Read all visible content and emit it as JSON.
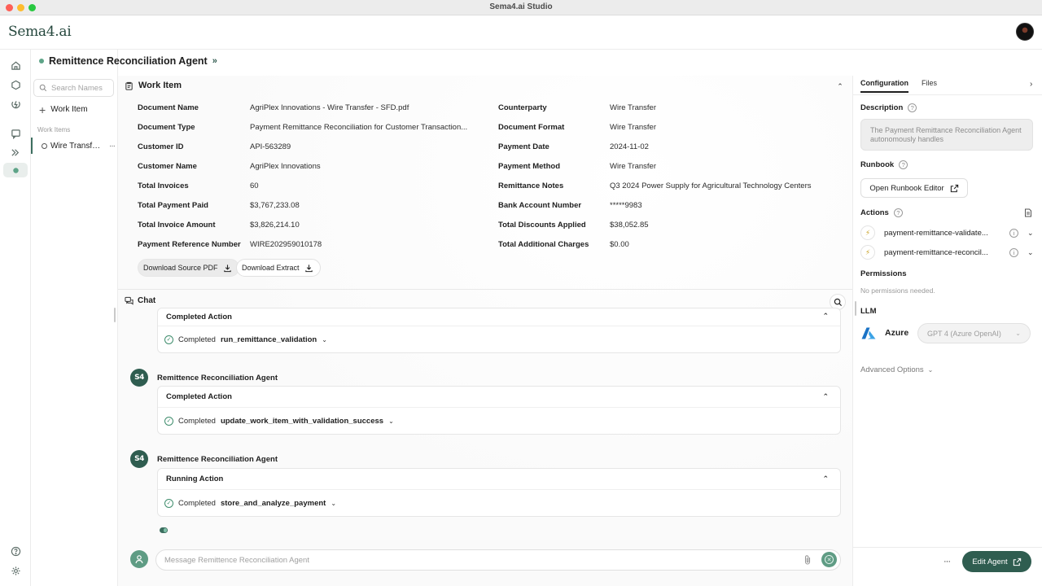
{
  "window": {
    "title": "Sema4.ai Studio"
  },
  "app": {
    "logo": "Sema4.ai"
  },
  "agent": {
    "name": "Remittence Reconciliation Agent",
    "chevrons": "»"
  },
  "sidebar": {
    "search_placeholder": "Search Names",
    "add_label": "Work Item",
    "section_label": "Work Items",
    "items": [
      {
        "label": "Wire Transfer..."
      }
    ]
  },
  "work_item": {
    "title": "Work Item",
    "left_fields": [
      {
        "key": "Document Name",
        "value": "AgriPlex Innovations - Wire Transfer - SFD.pdf"
      },
      {
        "key": "Document Type",
        "value": "Payment Remittance Reconciliation for Customer Transaction..."
      },
      {
        "key": "Customer ID",
        "value": "API-563289"
      },
      {
        "key": "Customer Name",
        "value": "AgriPlex Innovations"
      },
      {
        "key": "Total Invoices",
        "value": "60"
      },
      {
        "key": "Total Payment Paid",
        "value": "$3,767,233.08"
      },
      {
        "key": "Total Invoice Amount",
        "value": "$3,826,214.10"
      },
      {
        "key": "Payment Reference Number",
        "value": "WIRE202959010178"
      }
    ],
    "right_fields": [
      {
        "key": "Counterparty",
        "value": "Wire Transfer"
      },
      {
        "key": "Document Format",
        "value": "Wire Transfer"
      },
      {
        "key": "Payment Date",
        "value": "2024-11-02"
      },
      {
        "key": "Payment Method",
        "value": "Wire Transfer"
      },
      {
        "key": "Remittance Notes",
        "value": "Q3 2024 Power Supply for Agricultural Technology Centers"
      },
      {
        "key": "Bank Account Number",
        "value": "*****9983"
      },
      {
        "key": "Total Discounts Applied",
        "value": "$38,052.85"
      },
      {
        "key": "Total Additional Charges",
        "value": "$0.00"
      }
    ],
    "download_pdf": "Download Source PDF",
    "download_extract": "Download Extract"
  },
  "chat": {
    "title": "Chat",
    "agent_avatar": "S4",
    "messages": [
      {
        "sender": "",
        "card_title": "Completed Action",
        "status": "Completed",
        "action": "run_remittance_validation"
      },
      {
        "sender": "Remittence Reconciliation Agent",
        "card_title": "Completed Action",
        "status": "Completed",
        "action": "update_work_item_with_validation_success"
      },
      {
        "sender": "Remittence Reconciliation Agent",
        "card_title": "Running Action",
        "status": "Completed",
        "action": "store_and_analyze_payment"
      }
    ],
    "input_placeholder": "Message Remittence Reconciliation Agent"
  },
  "config": {
    "tabs": [
      "Configuration",
      "Files"
    ],
    "description_label": "Description",
    "description_text": "The Payment Remittance Reconciliation Agent autonomously handles",
    "runbook_label": "Runbook",
    "runbook_button": "Open Runbook Editor",
    "actions_label": "Actions",
    "actions": [
      {
        "name": "payment-remittance-validate..."
      },
      {
        "name": "payment-remittance-reconcil..."
      }
    ],
    "permissions_label": "Permissions",
    "permissions_text": "No permissions needed.",
    "llm_label": "LLM",
    "llm_provider": "Azure",
    "llm_model": "GPT 4 (Azure OpenAI)",
    "advanced_label": "Advanced Options",
    "more_label": "···",
    "edit_agent": "Edit Agent"
  },
  "colors": {
    "brand": "#2f5d50",
    "accent": "#5f9c84",
    "status_dot": "#5ea488"
  }
}
